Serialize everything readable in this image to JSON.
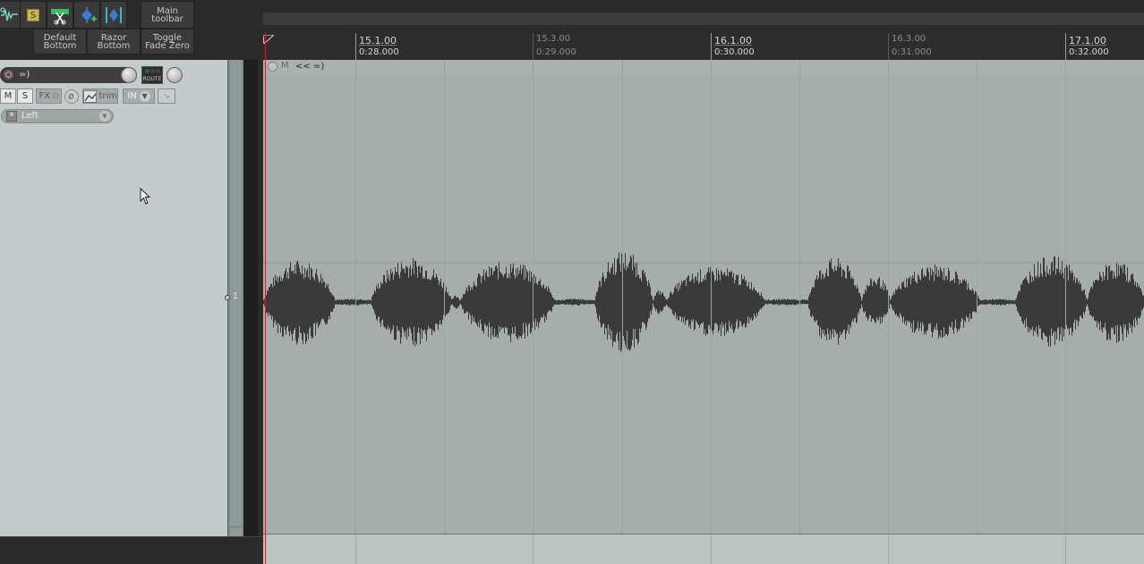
{
  "toolbar": {
    "icons": [
      {
        "name": "envelope-wave-icon"
      },
      {
        "name": "solo-icon",
        "label": "S"
      },
      {
        "name": "split-item-icon"
      },
      {
        "name": "add-marker-icon"
      },
      {
        "name": "region-marker-icon"
      }
    ],
    "main_toolbar_line1": "Main",
    "main_toolbar_line2": "toolbar",
    "default_bottom_line1": "Default",
    "default_bottom_line2": "Bottom",
    "razor_bottom_line1": "Razor",
    "razor_bottom_line2": "Bottom",
    "toggle_fade_line1": "Toggle",
    "toggle_fade_line2": "Fade Zero"
  },
  "ruler": {
    "marks": [
      {
        "bar": "15.1.00",
        "time": "0:28.000",
        "major": true
      },
      {
        "bar": "15.3.00",
        "time": "0:29.000",
        "major": false
      },
      {
        "bar": "16.1.00",
        "time": "0:30.000",
        "major": true
      },
      {
        "bar": "16.3.00",
        "time": "0:31.000",
        "major": false
      },
      {
        "bar": "17.1.00",
        "time": "0:32.000",
        "major": true
      }
    ]
  },
  "track": {
    "name": "=)",
    "route_label": "ROUTE",
    "mute_label": "M",
    "solo_label": "S",
    "fx_label": "FX",
    "trim_label": "trim",
    "in_label": "IN",
    "fx_chip_label": "Left",
    "track_number": "1"
  },
  "item": {
    "mute_label": "M",
    "name": "<< =)"
  },
  "colors": {
    "arrange_bg": "#a6adad",
    "waveform": "#3a3a3a",
    "tcp_bg": "#c3cccc",
    "edit_cursor": "#c02828"
  }
}
